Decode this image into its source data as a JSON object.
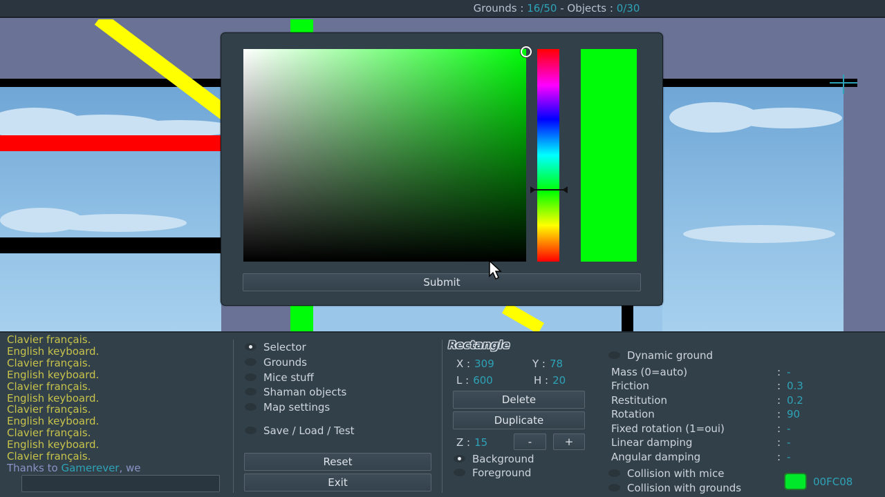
{
  "topbar": {
    "grounds_label": "Grounds :",
    "grounds_value": "16/50",
    "separator": "-",
    "objects_label": "Objects :",
    "objects_value": "0/30"
  },
  "color_picker": {
    "submit_label": "Submit",
    "selected_color": "#00fc08"
  },
  "chat": {
    "lines": [
      "Clavier français.",
      "English keyboard.",
      "Clavier français.",
      "English keyboard.",
      "Clavier français.",
      "English keyboard.",
      "Clavier français.",
      "English keyboard.",
      "Clavier français.",
      "English keyboard.",
      "Clavier français."
    ],
    "info_prefix": "Thanks to ",
    "info_name": "Gamerever",
    "info_suffix": ", we",
    "input_value": ""
  },
  "menu": {
    "items": [
      {
        "label": "Selector",
        "selected": true
      },
      {
        "label": "Grounds",
        "selected": false
      },
      {
        "label": "Mice stuff",
        "selected": false
      },
      {
        "label": "Shaman objects",
        "selected": false
      },
      {
        "label": "Map settings",
        "selected": false
      }
    ],
    "save_load_label": "Save / Load / Test",
    "reset_label": "Reset",
    "exit_label": "Exit"
  },
  "object_panel": {
    "title": "Rectangle",
    "x_label": "X :",
    "x_value": "309",
    "y_label": "Y :",
    "y_value": "78",
    "l_label": "L :",
    "l_value": "600",
    "h_label": "H :",
    "h_value": "20",
    "delete_label": "Delete",
    "duplicate_label": "Duplicate",
    "z_label": "Z :",
    "z_value": "15",
    "minus_label": "-",
    "plus_label": "+",
    "background_label": "Background",
    "foreground_label": "Foreground",
    "layer_selected": "Background"
  },
  "properties": {
    "dynamic_label": "Dynamic ground",
    "rows": [
      {
        "label": "Mass (0=auto)",
        "value": "-"
      },
      {
        "label": "Friction",
        "value": "0.3"
      },
      {
        "label": "Restitution",
        "value": "0.2"
      },
      {
        "label": "Rotation",
        "value": "90"
      },
      {
        "label": "Fixed rotation (1=oui)",
        "value": "-"
      },
      {
        "label": "Linear damping",
        "value": "-"
      },
      {
        "label": "Angular damping",
        "value": "-"
      }
    ],
    "colon": ":",
    "collision_mice_label": "Collision with mice",
    "collision_grounds_label": "Collision with grounds",
    "color_hex": "00FC08",
    "color_swatch": "#00e82a"
  }
}
